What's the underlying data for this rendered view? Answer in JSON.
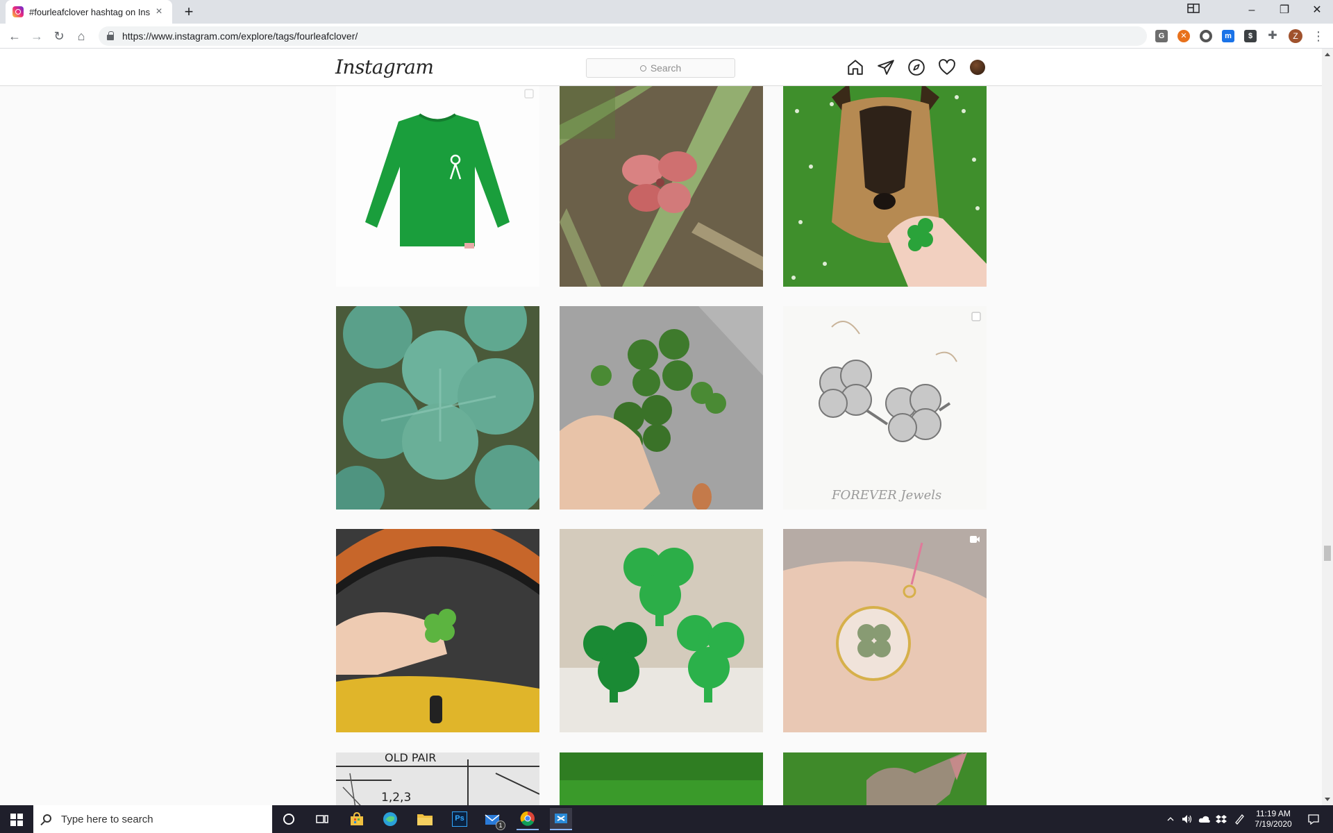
{
  "browser": {
    "tab_title": "#fourleafclover hashtag on Insta...",
    "tab_close": "×",
    "new_tab": "+",
    "url": "https://www.instagram.com/explore/tags/fourleafclover/",
    "profile_initial": "Z",
    "window_controls": {
      "minimize": "–",
      "maximize": "❐",
      "close": "✕"
    },
    "nav": {
      "back": "←",
      "forward": "→",
      "reload": "↻",
      "home": "⌂",
      "menu": "⋮"
    }
  },
  "instagram": {
    "logo": "Instagram",
    "search_placeholder": "Search",
    "posts": [
      {
        "id": "green-shirt",
        "badge": "carousel"
      },
      {
        "id": "red-clover",
        "badge": "none"
      },
      {
        "id": "dog-clover",
        "badge": "none"
      },
      {
        "id": "clover-leaves",
        "badge": "none"
      },
      {
        "id": "hand-clover",
        "badge": "none"
      },
      {
        "id": "earrings",
        "badge": "carousel"
      },
      {
        "id": "car-clover",
        "badge": "none"
      },
      {
        "id": "shamrock-shapes",
        "badge": "none"
      },
      {
        "id": "pendant",
        "badge": "video"
      },
      {
        "id": "sketch",
        "badge": "none"
      },
      {
        "id": "grass",
        "badge": "none"
      },
      {
        "id": "cat-grass",
        "badge": "none"
      }
    ],
    "earrings_text": "FOREVER Jewels",
    "sketch_text": "OLD PAIR",
    "sketch_number": "1,2,3"
  },
  "taskbar": {
    "search_placeholder": "Type here to search",
    "time": "11:19 AM",
    "date": "7/19/2020",
    "mail_badge": "1",
    "ps_label": "Ps"
  }
}
